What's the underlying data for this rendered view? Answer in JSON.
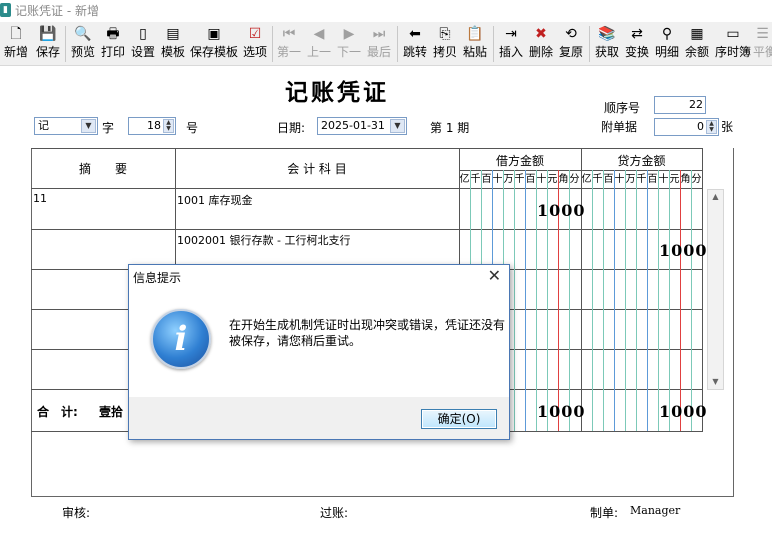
{
  "window": {
    "title": "记账凭证 - 新增"
  },
  "toolbar": {
    "new_label": "新增",
    "save_label": "保存",
    "preview_label": "预览",
    "print_label": "打印",
    "settings_label": "设置",
    "template_label": "模板",
    "save_template_label": "保存模板",
    "options_label": "选项",
    "first_label": "第一",
    "prev_label": "上一",
    "next_label": "下一",
    "last_label": "最后",
    "jump_label": "跳转",
    "copy_label": "拷贝",
    "paste_label": "粘贴",
    "insert_label": "插入",
    "delete_label": "删除",
    "restore_label": "复原",
    "fetch_label": "获取",
    "exchange_label": "变换",
    "detail_label": "明细",
    "balance_label": "余额",
    "journal_label": "序时簿",
    "balance_check_label": "平衡"
  },
  "voucher": {
    "title": "记账凭证",
    "word_type": "记",
    "word_label": "字",
    "number": "18",
    "number_label": "号",
    "date_label": "日期:",
    "date": "2025-01-31",
    "period": "第 1 期",
    "sequence_label": "顺序号",
    "sequence": "22",
    "attach_label": "附单据",
    "attach_count": "0",
    "attach_unit": "张"
  },
  "table": {
    "col_summary": "摘　　要",
    "col_account": "会 计 科 目",
    "col_debit": "借方金额",
    "col_credit": "贷方金额",
    "digits": [
      "亿",
      "千",
      "百",
      "十",
      "万",
      "千",
      "百",
      "十",
      "元",
      "角",
      "分"
    ],
    "rows": [
      {
        "summary": "11",
        "account": "1001 库存现金",
        "debit": "1000",
        "credit": ""
      },
      {
        "summary": "",
        "account": "1002001 银行存款 - 工行柯北支行",
        "debit": "",
        "credit": "1000"
      }
    ],
    "total_label": "合　计:",
    "total_words": "壹拾",
    "total_debit": "1000",
    "total_credit": "1000"
  },
  "footer": {
    "review_label": "审核:",
    "posting_label": "过账:",
    "maker_label": "制单:",
    "maker": "Manager"
  },
  "dialog": {
    "title": "信息提示",
    "message": "在开始生成机制凭证时出现冲突或错误，凭证还没有被保存，请您稍后重试。",
    "ok_label": "确定(O)"
  }
}
